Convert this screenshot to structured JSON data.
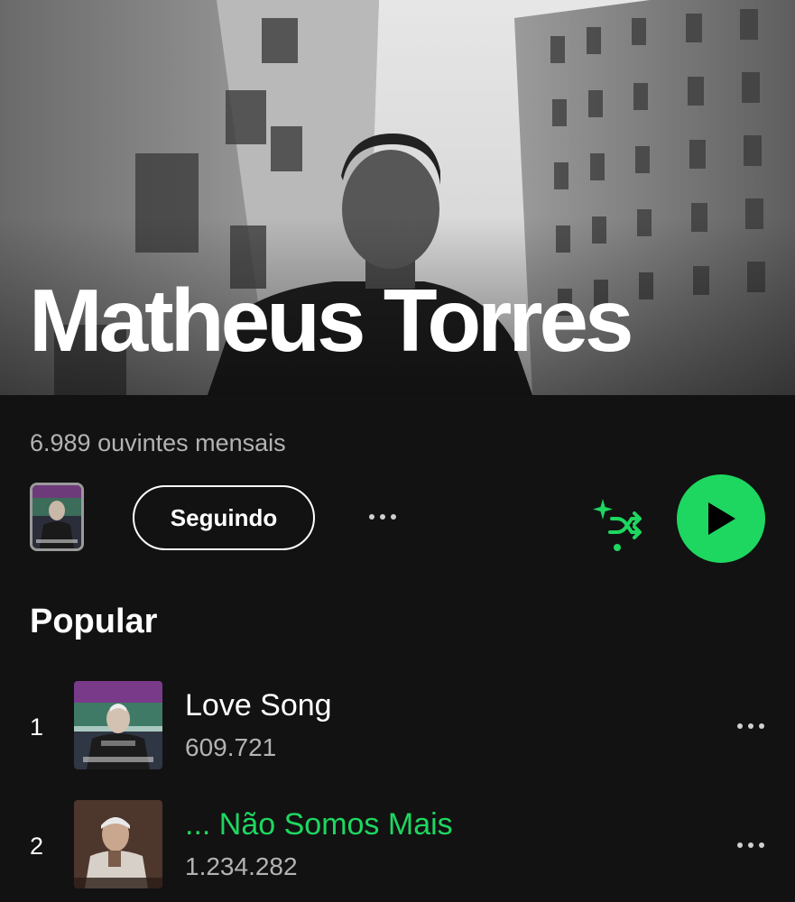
{
  "artist": {
    "name": "Matheus Torres",
    "monthly_listeners": "6.989 ouvintes mensais"
  },
  "actions": {
    "follow_label": "Seguindo",
    "more_icon": "more-horizontal-icon",
    "shuffle_icon": "smart-shuffle-icon",
    "play_icon": "play-icon"
  },
  "popular": {
    "title": "Popular",
    "tracks": [
      {
        "number": "1",
        "title": "Love Song",
        "plays": "609.721",
        "playing": false
      },
      {
        "number": "2",
        "title": "... Não Somos Mais",
        "plays": "1.234.282",
        "playing": true
      }
    ]
  },
  "colors": {
    "background": "#121212",
    "accent": "#1ed760",
    "secondary_text": "#b3b3b3"
  }
}
